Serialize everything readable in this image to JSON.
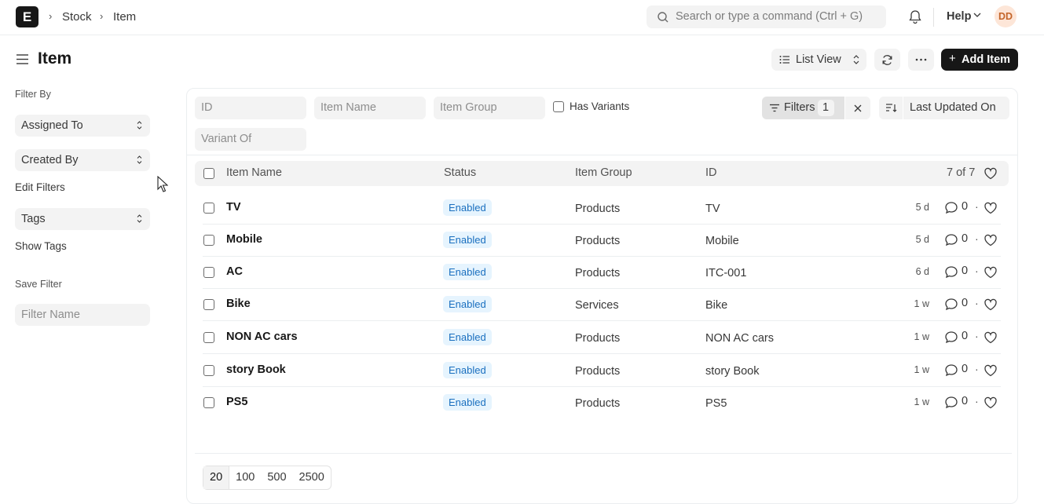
{
  "navbar": {
    "logo": "E",
    "breadcrumbs": [
      "Stock",
      "Item"
    ],
    "search_placeholder": "Search or type a command (Ctrl + G)",
    "help_label": "Help",
    "avatar_initials": "DD"
  },
  "page": {
    "title": "Item",
    "list_view_label": "List View",
    "add_label": "Add Item"
  },
  "sidebar": {
    "filter_by": "Filter By",
    "assigned_to": "Assigned To",
    "created_by": "Created By",
    "edit_filters": "Edit Filters",
    "tags": "Tags",
    "show_tags": "Show Tags",
    "save_filter": "Save Filter",
    "filter_name_placeholder": "Filter Name"
  },
  "filters": {
    "id_placeholder": "ID",
    "item_name_placeholder": "Item Name",
    "item_group_placeholder": "Item Group",
    "has_variants": "Has Variants",
    "variant_of_placeholder": "Variant Of",
    "filters_label": "Filters",
    "filters_count": "1",
    "sort_label": "Last Updated On"
  },
  "table": {
    "headers": {
      "name": "Item Name",
      "status": "Status",
      "group": "Item Group",
      "id": "ID",
      "count": "7 of 7"
    },
    "rows": [
      {
        "name": "TV",
        "status": "Enabled",
        "group": "Products",
        "id": "TV",
        "modified": "5 d",
        "comments": "0"
      },
      {
        "name": "Mobile",
        "status": "Enabled",
        "group": "Products",
        "id": "Mobile",
        "modified": "5 d",
        "comments": "0"
      },
      {
        "name": "AC",
        "status": "Enabled",
        "group": "Products",
        "id": "ITC-001",
        "modified": "6 d",
        "comments": "0"
      },
      {
        "name": "Bike",
        "status": "Enabled",
        "group": "Services",
        "id": "Bike",
        "modified": "1 w",
        "comments": "0"
      },
      {
        "name": "NON AC cars",
        "status": "Enabled",
        "group": "Products",
        "id": "NON AC cars",
        "modified": "1 w",
        "comments": "0"
      },
      {
        "name": "story Book",
        "status": "Enabled",
        "group": "Products",
        "id": "story Book",
        "modified": "1 w",
        "comments": "0"
      },
      {
        "name": "PS5",
        "status": "Enabled",
        "group": "Products",
        "id": "PS5",
        "modified": "1 w",
        "comments": "0"
      }
    ]
  },
  "paging": [
    "20",
    "100",
    "500",
    "2500"
  ],
  "colors": {
    "primary_button": "#171717",
    "badge_bg": "#e6f4fe",
    "badge_text": "#1a6fbf"
  }
}
